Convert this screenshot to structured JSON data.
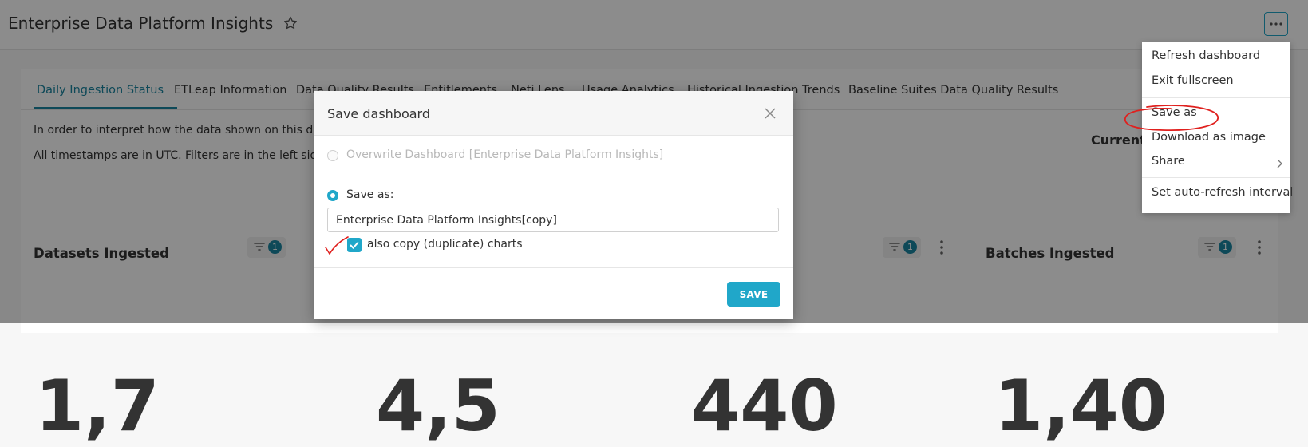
{
  "header": {
    "title": "Enterprise Data Platform Insights",
    "star_icon": "star-icon",
    "more_icon": "more-horizontal-icon"
  },
  "tabs": [
    {
      "label": "Daily Ingestion Status",
      "active": true
    },
    {
      "label": "ETLeap Information"
    },
    {
      "label": "Data Quality Results"
    },
    {
      "label": "Entitlements"
    },
    {
      "label": "Neti Lens"
    },
    {
      "label": "Usage Analytics"
    },
    {
      "label": "Historical Ingestion Trends"
    },
    {
      "label": "Baseline Suites Data Quality Results"
    }
  ],
  "info": {
    "line1": "In order to interpret how the data shown on this dash",
    "line2": "All timestamps are in UTC. Filters are in the left side b",
    "current": "Current"
  },
  "charts": [
    {
      "title": "Datasets Ingested",
      "filter_count": "1",
      "big_value": "1,7"
    },
    {
      "title": "",
      "filter_count": "1",
      "big_value": "4,5"
    },
    {
      "title": "Batches Ingested",
      "filter_count": "1",
      "big_value": "1,40"
    }
  ],
  "big_value_mid": "440",
  "menu": {
    "items": [
      {
        "label": "Refresh dashboard"
      },
      {
        "label": "Exit fullscreen"
      },
      {
        "label": "Save as"
      },
      {
        "label": "Download as image"
      },
      {
        "label": "Share"
      },
      {
        "label": "Set auto-refresh interval"
      }
    ]
  },
  "modal": {
    "title": "Save dashboard",
    "overwrite_label": "Overwrite Dashboard [Enterprise Data Platform Insights]",
    "save_as_label": "Save as:",
    "name_value": "Enterprise Data Platform Insights[copy]",
    "duplicate_label": "also copy (duplicate) charts",
    "duplicate_checked": true,
    "save_button": "SAVE"
  },
  "colors": {
    "accent": "#20a7c9",
    "tab_active": "#1a85a0",
    "annotation": "#e0201e"
  }
}
